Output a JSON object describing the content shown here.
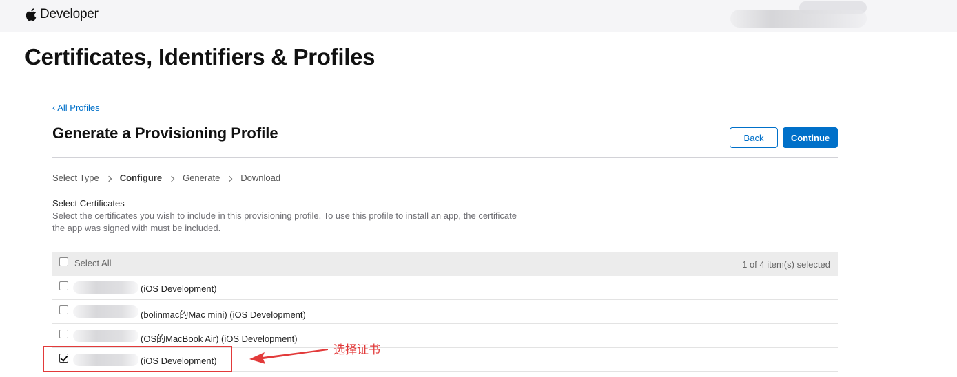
{
  "header": {
    "brand": "Developer",
    "logo_icon": "apple-logo-icon"
  },
  "page": {
    "title": "Certificates, Identifiers & Profiles"
  },
  "section": {
    "back_link": "‹ All Profiles",
    "title": "Generate a Provisioning Profile",
    "back_button": "Back",
    "continue_button": "Continue"
  },
  "steps": [
    {
      "label": "Select Type",
      "active": false
    },
    {
      "label": "Configure",
      "active": true
    },
    {
      "label": "Generate",
      "active": false
    },
    {
      "label": "Download",
      "active": false
    }
  ],
  "certificates": {
    "heading": "Select Certificates",
    "description": "Select the certificates you wish to include in this provisioning profile. To use this profile to install an app, the certificate the app was signed with must be included.",
    "select_all": "Select All",
    "count": "1 of 4 item(s) selected",
    "rows": [
      {
        "label": "(iOS Development)",
        "checked": false
      },
      {
        "label": "(bolinmac的Mac mini) (iOS Development)",
        "checked": false
      },
      {
        "label": "(OS的MacBook Air) (iOS Development)",
        "checked": false
      },
      {
        "label": "(iOS Development)",
        "checked": true
      }
    ]
  },
  "annotation": {
    "text": "选择证书",
    "color": "#e23a3a"
  },
  "colors": {
    "accent": "#0070c9",
    "annotation_red": "#e23a3a",
    "header_bg": "#f5f5f7"
  }
}
